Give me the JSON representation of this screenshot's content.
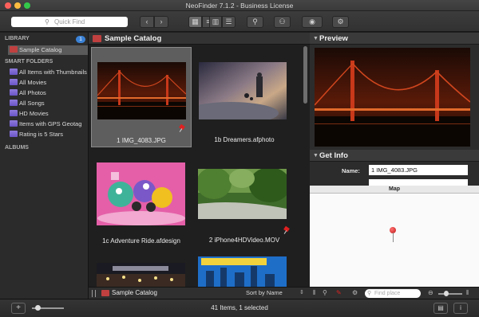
{
  "window": {
    "title": "NeoFinder 7.1.2 - Business License"
  },
  "toolbar": {
    "quick_find_placeholder": "Quick Find",
    "back_glyph": "‹",
    "forward_glyph": "›",
    "search_glyph": "⚲",
    "users_glyph": "⚇",
    "eye_glyph": "◉",
    "gear_glyph": "⚙",
    "view_glyphs": [
      "▦",
      "≡",
      "▥",
      "☰"
    ]
  },
  "sidebar": {
    "library_label": "LIBRARY",
    "library_badge": "1",
    "catalog": "Sample Catalog",
    "smart_folders_label": "SMART FOLDERS",
    "smart_folders": [
      "All Items with Thumbnails",
      "All Movies",
      "All Photos",
      "All Songs",
      "HD Movies",
      "Items with GPS Geotag",
      "Rating is 5 Stars"
    ],
    "albums_label": "ALBUMS"
  },
  "browser": {
    "title": "Sample Catalog",
    "items": [
      {
        "name": "1 IMG_4083.JPG",
        "selected": true,
        "pinned": true
      },
      {
        "name": "1b Dreamers.afphoto",
        "selected": false,
        "pinned": false
      },
      {
        "name": "1c Adventure Ride.afdesign",
        "selected": false,
        "pinned": false
      },
      {
        "name": "2 iPhone4HDVideo.MOV",
        "selected": false,
        "pinned": true
      },
      {
        "name": "",
        "selected": false,
        "pinned": false
      },
      {
        "name": "",
        "selected": false,
        "pinned": false
      }
    ],
    "footer_catalog": "Sample Catalog",
    "sort_label": "Sort by Name",
    "sort_arrows": "⇕"
  },
  "inspector": {
    "preview_label": "Preview",
    "get_info_label": "Get Info",
    "name_label": "Name:",
    "name_value": "1 IMG_4083.JPG",
    "map_label": "Map",
    "find_place_placeholder": "Find place"
  },
  "status": {
    "text": "41 Items, 1 selected",
    "add_glyph": "+",
    "map_glyph": "▤",
    "info_glyph": "i"
  },
  "colors": {
    "accent": "#3b82d6",
    "pin": "#e02020",
    "smart_folder": "#7a66d2"
  }
}
